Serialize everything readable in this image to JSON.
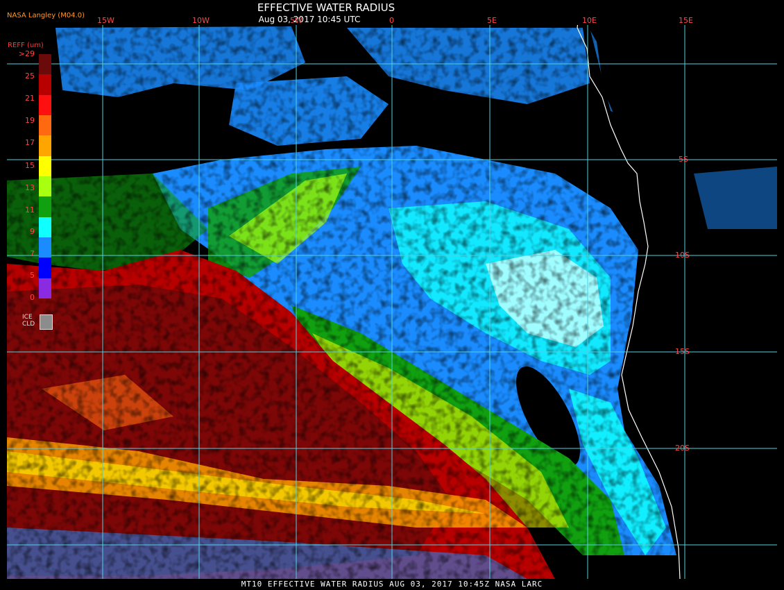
{
  "header": {
    "title": "EFFECTIVE WATER RADIUS",
    "subtitle": "Aug 03, 2017 10:45 UTC",
    "credit": "NASA Langley (M04.0)"
  },
  "footer": {
    "caption": "MT10  EFFECTIVE WATER RADIUS  AUG 03, 2017 10:45Z  NASA LARC"
  },
  "map": {
    "longitude_labels": [
      "15W",
      "10W",
      "5W",
      "0",
      "5E",
      "10E",
      "15E"
    ],
    "latitude_labels": [
      "5S",
      "10S",
      "15S",
      "20S"
    ],
    "gridline_color": "#4fd0e0",
    "label_color": "#ff4a4a",
    "coastline_color": "#ffffff"
  },
  "legend": {
    "title": "REFF (um)",
    "top_label": ">29",
    "labels": [
      "25",
      "21",
      "19",
      "17",
      "15",
      "13",
      "11",
      "9",
      "7",
      "5",
      "0"
    ],
    "colors": [
      "#6a0a0a",
      "#b80000",
      "#ff1010",
      "#ff6a10",
      "#ffa500",
      "#ffff00",
      "#a8ff10",
      "#10a010",
      "#10ffff",
      "#1a8cff",
      "#0000ff",
      "#8a2be2"
    ],
    "ice_label_1": "ICE",
    "ice_label_2": "CLD",
    "ice_color": "#8c8c8c"
  }
}
